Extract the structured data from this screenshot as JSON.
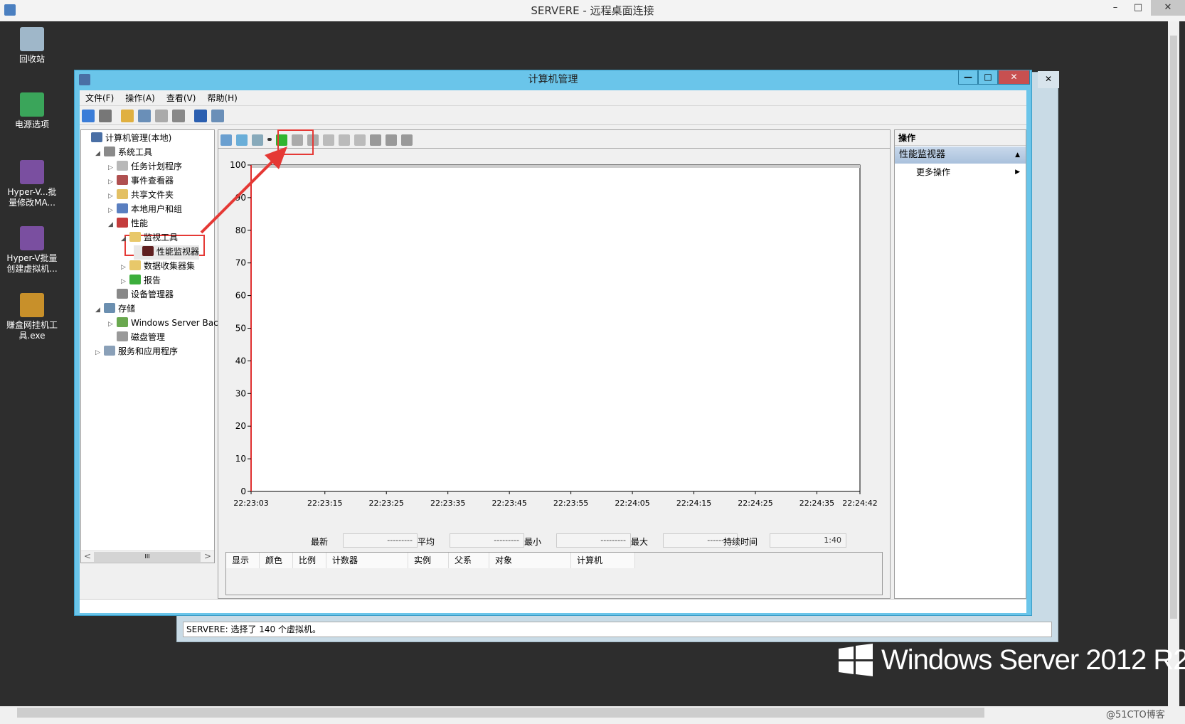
{
  "rdp": {
    "title": "SERVERE - 远程桌面连接",
    "min": "–",
    "max": "□",
    "close": "✕"
  },
  "desktop": {
    "icons": [
      {
        "label": "回收站",
        "color": "#9fb7c9"
      },
      {
        "label": "电源选项",
        "color": "#3aa55a"
      },
      {
        "label": "Hyper-V...批量修改MA...",
        "color": "#7a4fa0"
      },
      {
        "label": "Hyper-V批量创建虚拟机...",
        "color": "#7a4fa0"
      },
      {
        "label": "赚盒网挂机工具.exe",
        "color": "#c8902a"
      }
    ],
    "brand": "Windows Server 2012 R2",
    "watermark": "@51CTO博客"
  },
  "back_window": {
    "status": "SERVERE: 选择了 140 个虚拟机。",
    "close": "✕"
  },
  "window": {
    "title": "计算机管理",
    "min": "—",
    "max": "□",
    "close": "✕",
    "menu": [
      "文件(F)",
      "操作(A)",
      "查看(V)",
      "帮助(H)"
    ],
    "toolbar_icons": [
      "back-icon",
      "forward-icon",
      "up-folder-icon",
      "show-hide-tree-icon",
      "properties-icon",
      "print-icon",
      "help-icon",
      "show-action-pane-icon"
    ]
  },
  "tree": [
    {
      "label": "计算机管理(本地)",
      "level": 0,
      "exp": "",
      "color": "#4a6fa5"
    },
    {
      "label": "系统工具",
      "level": 1,
      "exp": "◢",
      "color": "#8a8a8a"
    },
    {
      "label": "任务计划程序",
      "level": 2,
      "exp": "▷",
      "color": "#b8b8b8"
    },
    {
      "label": "事件查看器",
      "level": 2,
      "exp": "▷",
      "color": "#b05050"
    },
    {
      "label": "共享文件夹",
      "level": 2,
      "exp": "▷",
      "color": "#e3c064"
    },
    {
      "label": "本地用户和组",
      "level": 2,
      "exp": "▷",
      "color": "#5a7fc0"
    },
    {
      "label": "性能",
      "level": 2,
      "exp": "◢",
      "color": "#c43c3c"
    },
    {
      "label": "监视工具",
      "level": 3,
      "exp": "◢",
      "color": "#e8c86a"
    },
    {
      "label": "性能监视器",
      "level": 4,
      "exp": "",
      "color": "#602020"
    },
    {
      "label": "数据收集器集",
      "level": 3,
      "exp": "▷",
      "color": "#e8c86a"
    },
    {
      "label": "报告",
      "level": 3,
      "exp": "▷",
      "color": "#3cae3c"
    },
    {
      "label": "设备管理器",
      "level": 2,
      "exp": "",
      "color": "#888"
    },
    {
      "label": "存储",
      "level": 1,
      "exp": "◢",
      "color": "#6b8fb0"
    },
    {
      "label": "Windows Server Back",
      "level": 2,
      "exp": "▷",
      "color": "#6aa84f"
    },
    {
      "label": "磁盘管理",
      "level": 2,
      "exp": "",
      "color": "#999"
    },
    {
      "label": "服务和应用程序",
      "level": 1,
      "exp": "▷",
      "color": "#8aa0b8"
    }
  ],
  "tree_scroll": {
    "left": "<",
    "right": ">",
    "thumb": "III"
  },
  "chart_toolbar": [
    "view-graph-icon",
    "freeze-icon",
    "change-graph-type-icon",
    "dropdown-icon",
    "add-counter-icon",
    "delete-counter-icon",
    "highlight-icon",
    "copy-properties-icon",
    "paste-counter-icon",
    "properties-icon",
    "zoom-icon",
    "pause-icon",
    "update-data-icon"
  ],
  "chart_data": {
    "type": "line",
    "series": [],
    "ylim": [
      0,
      100
    ],
    "yticks": [
      "100",
      "90",
      "80",
      "70",
      "60",
      "50",
      "40",
      "30",
      "20",
      "10",
      "0"
    ],
    "xticks": [
      "22:23:03",
      "22:23:15",
      "22:23:25",
      "22:23:35",
      "22:23:45",
      "22:23:55",
      "22:24:05",
      "22:24:15",
      "22:24:25",
      "22:24:35",
      "22:24:42"
    ],
    "cursor_color": "#e03030"
  },
  "stats": [
    {
      "label": "最新",
      "value": "---------"
    },
    {
      "label": "平均",
      "value": "---------"
    },
    {
      "label": "最小",
      "value": "---------"
    },
    {
      "label": "最大",
      "value": "---------"
    },
    {
      "label": "持续时间",
      "value": "1:40"
    }
  ],
  "counter_columns": [
    "显示",
    "颜色",
    "比例",
    "计数器",
    "实例",
    "父系",
    "对象",
    "计算机"
  ],
  "actions": {
    "header": "操作",
    "group": "性能监视器",
    "group_arrow": "▲",
    "item": "更多操作",
    "item_arrow": "▶"
  }
}
